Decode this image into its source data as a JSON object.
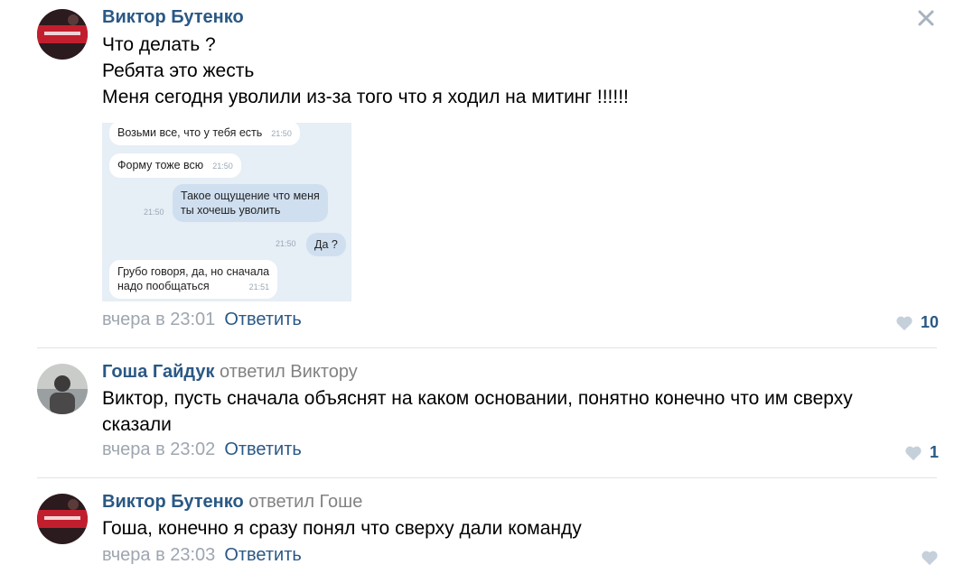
{
  "comments": [
    {
      "author": "Виктор Бутенко",
      "reply_to": "",
      "lines": [
        "Что делать ?",
        "Ребята это жесть",
        "Меня сегодня уволили из-за того что я ходил на митинг !!!!!!"
      ],
      "time": "вчера в 23:01",
      "reply_label": "Ответить",
      "likes": "10"
    },
    {
      "author": "Гоша Гайдук",
      "reply_to": "ответил Виктору",
      "lines": [
        "Виктор, пусть сначала объяснят на каком основании, понятно конечно что им сверху",
        "сказали"
      ],
      "time": "вчера в 23:02",
      "reply_label": "Ответить",
      "likes": "1"
    },
    {
      "author": "Виктор Бутенко",
      "reply_to": "ответил Гоше",
      "lines": [
        "Гоша, конечно я сразу понял что сверху дали команду"
      ],
      "time": "вчера в 23:03",
      "reply_label": "Ответить",
      "likes": ""
    }
  ],
  "chat_screenshot": {
    "messages": [
      {
        "text": "Возьми все, что у тебя есть",
        "time": "21:50"
      },
      {
        "text": "Форму тоже всю",
        "time": "21:50"
      },
      {
        "line1": "Такое ощущение что меня",
        "line2": "ты хочешь уволить",
        "time": "21:50"
      },
      {
        "text": "Да ?",
        "time": "21:50"
      },
      {
        "line1": "Грубо говоря, да, но сначала",
        "line2": "надо пообщаться",
        "time": "21:51"
      }
    ]
  },
  "colors": {
    "link": "#2a5885",
    "meta": "#9da6b0",
    "heart": "#c5d0db"
  }
}
